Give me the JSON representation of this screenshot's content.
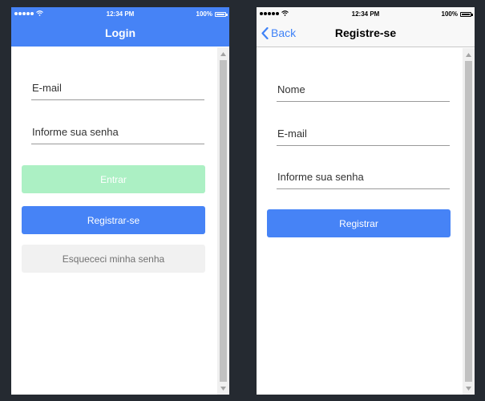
{
  "status_bar": {
    "time": "12:34 PM",
    "battery": "100%"
  },
  "login": {
    "title": "Login",
    "email_placeholder": "E-mail",
    "password_placeholder": "Informe sua senha",
    "enter_button": "Entrar",
    "register_button": "Registrar-se",
    "forgot_button": "Esquececi minha senha"
  },
  "register": {
    "back_label": "Back",
    "title": "Registre-se",
    "name_placeholder": "Nome",
    "email_placeholder": "E-mail",
    "password_placeholder": "Informe sua senha",
    "register_button": "Registrar"
  },
  "icons": {
    "signal": "signal-dots-icon",
    "wifi": "wifi-icon",
    "battery": "battery-icon",
    "back": "chevron-left-icon",
    "scroll_up": "scroll-up-arrow-icon",
    "scroll_down": "scroll-down-arrow-icon"
  },
  "colors": {
    "accent": "#4683f6",
    "disabled_button": "#acf0c4",
    "secondary_button": "#f1f1f1",
    "background": "#252a31"
  }
}
